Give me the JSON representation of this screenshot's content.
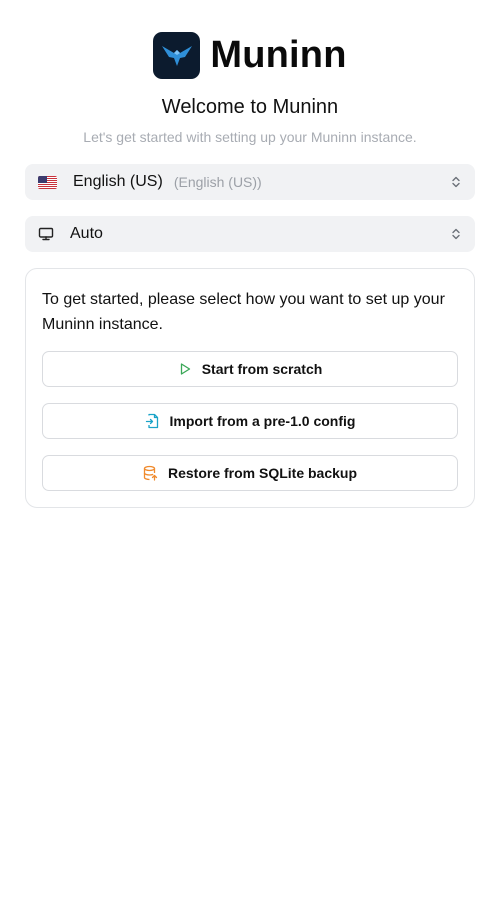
{
  "brand": {
    "name": "Muninn",
    "logo_icon": "raven-icon",
    "logo_bg": "#0c1b2e",
    "accent": "#2f8fd8"
  },
  "welcome": {
    "title": "Welcome to Muninn",
    "subtitle": "Let's get started with setting up your Muninn instance."
  },
  "language_select": {
    "icon": "us-flag-icon",
    "value": "English (US)",
    "native": "(English (US))"
  },
  "theme_select": {
    "icon": "monitor-icon",
    "value": "Auto"
  },
  "setup_card": {
    "prompt": "To get started, please select how you want to set up your Muninn instance.",
    "options": [
      {
        "label": "Start from scratch",
        "icon": "play-icon",
        "color": "#3aa757"
      },
      {
        "label": "Import from a pre-1.0 config",
        "icon": "file-import-icon",
        "color": "#1aa3c8"
      },
      {
        "label": "Restore from SQLite backup",
        "icon": "database-restore-icon",
        "color": "#f08a2c"
      }
    ]
  }
}
